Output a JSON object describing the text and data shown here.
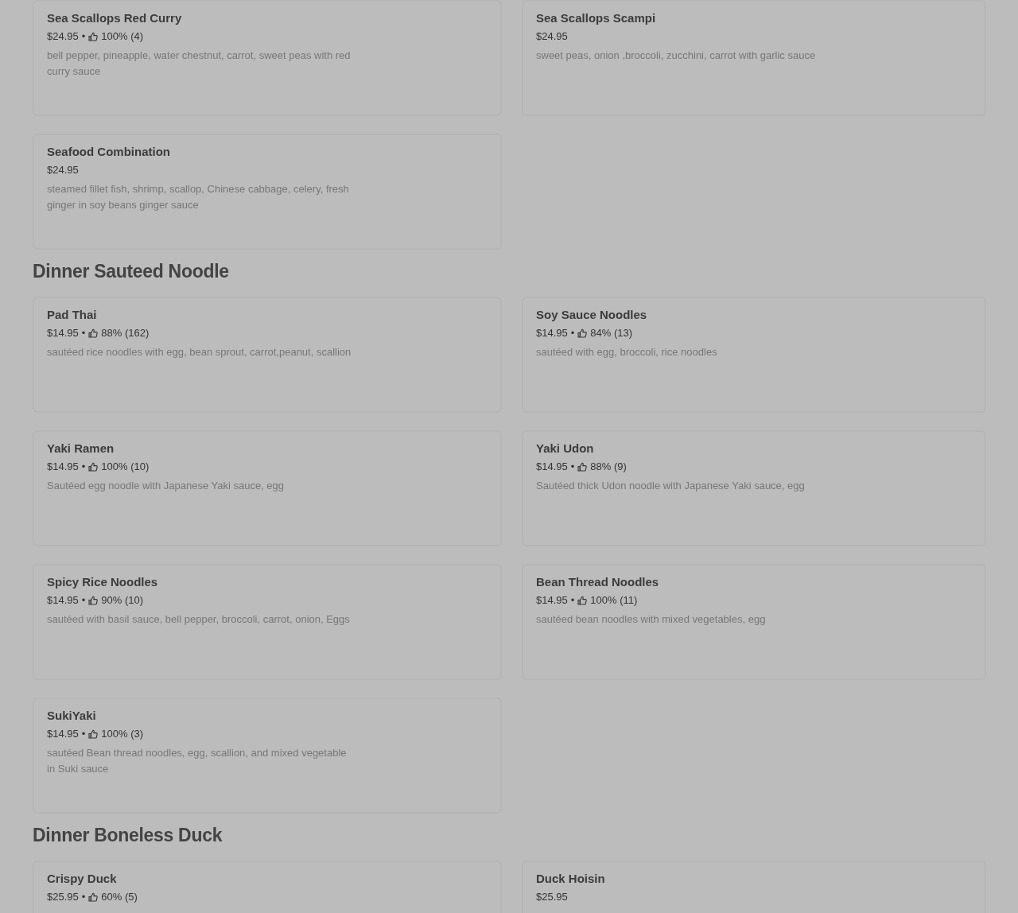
{
  "sections": [
    {
      "items": [
        {
          "name": "Sea Scallops Red Curry",
          "price": "$24.95",
          "separator": "•",
          "rating": "100% (4)",
          "description": "bell pepper, pineapple, water chestnut, carrot, sweet peas with red curry sauce"
        },
        {
          "name": "Sea Scallops Scampi",
          "price": "$24.95",
          "description": "sweet peas, onion ,broccoli, zucchini, carrot with garlic sauce"
        },
        {
          "name": "Seafood Combination",
          "price": "$24.95",
          "description": "steamed fillet fish, shrimp, scallop, Chinese cabbage, celery, fresh ginger in soy beans ginger sauce"
        }
      ]
    },
    {
      "heading": "Dinner Sauteed Noodle",
      "items": [
        {
          "name": "Pad Thai",
          "price": "$14.95",
          "separator": "•",
          "rating": "88% (162)",
          "description": "sautéed rice noodles with egg, bean sprout, carrot,peanut, scallion"
        },
        {
          "name": "Soy Sauce Noodles",
          "price": "$14.95",
          "separator": "•",
          "rating": "84% (13)",
          "description": "sautéed with egg, broccoli, rice noodles"
        },
        {
          "name": "Yaki Ramen",
          "price": "$14.95",
          "separator": "•",
          "rating": "100% (10)",
          "description": "Sautéed egg noodle with Japanese Yaki sauce, egg"
        },
        {
          "name": "Yaki Udon",
          "price": "$14.95",
          "separator": "•",
          "rating": "88% (9)",
          "description": "Sautéed thick Udon noodle with Japanese Yaki sauce, egg"
        },
        {
          "name": "Spicy Rice Noodles",
          "price": "$14.95",
          "separator": "•",
          "rating": "90% (10)",
          "description": "sautéed with basil sauce, bell pepper, broccoli, carrot, onion, Eggs"
        },
        {
          "name": "Bean Thread Noodles",
          "price": "$14.95",
          "separator": "•",
          "rating": "100% (11)",
          "description": "sautéed bean noodles with mixed vegetables, egg"
        },
        {
          "name": "SukiYaki",
          "price": "$14.95",
          "separator": "•",
          "rating": "100% (3)",
          "description": "sautéed Bean thread noodles, egg, scallion, and mixed vegetable in Suki sauce"
        }
      ]
    },
    {
      "heading": "Dinner Boneless Duck",
      "items": [
        {
          "name": "Crispy Duck",
          "price": "$25.95",
          "separator": "•",
          "rating": "60% (5)"
        },
        {
          "name": "Duck Hoisin",
          "price": "$25.95"
        }
      ]
    }
  ]
}
